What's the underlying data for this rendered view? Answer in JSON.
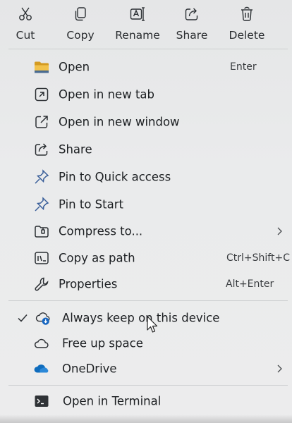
{
  "toolbar": {
    "buttons": [
      {
        "label": "Cut",
        "icon": "scissors-icon"
      },
      {
        "label": "Copy",
        "icon": "copy-icon"
      },
      {
        "label": "Rename",
        "icon": "rename-icon"
      },
      {
        "label": "Share",
        "icon": "share-icon"
      },
      {
        "label": "Delete",
        "icon": "trash-icon"
      }
    ]
  },
  "menu": {
    "items": [
      {
        "label": "Open",
        "shortcut": "Enter",
        "icon": "folder-icon"
      },
      {
        "label": "Open in new tab",
        "icon": "open-new-tab-icon"
      },
      {
        "label": "Open in new window",
        "icon": "open-new-window-icon"
      },
      {
        "label": "Share",
        "icon": "share-icon"
      },
      {
        "label": "Pin to Quick access",
        "icon": "pin-icon"
      },
      {
        "label": "Pin to Start",
        "icon": "pin-icon"
      },
      {
        "label": "Compress to...",
        "icon": "zip-folder-icon",
        "submenu": true
      },
      {
        "label": "Copy as path",
        "shortcut": "Ctrl+Shift+C",
        "icon": "copy-path-icon"
      },
      {
        "label": "Properties",
        "shortcut": "Alt+Enter",
        "icon": "wrench-icon"
      },
      {
        "label": "Always keep on this device",
        "icon": "cloud-download-icon",
        "checked": true
      },
      {
        "label": "Free up space",
        "icon": "cloud-icon"
      },
      {
        "label": "OneDrive",
        "icon": "onedrive-icon",
        "submenu": true
      },
      {
        "label": "Open in Terminal",
        "icon": "terminal-icon"
      }
    ]
  },
  "colors": {
    "background": "#e8e9ea",
    "text": "#1c1f22",
    "folder_yellow": "#e8b73a",
    "onedrive_blue": "#0f6cbd",
    "cloud_badge_blue": "#1565c0"
  }
}
